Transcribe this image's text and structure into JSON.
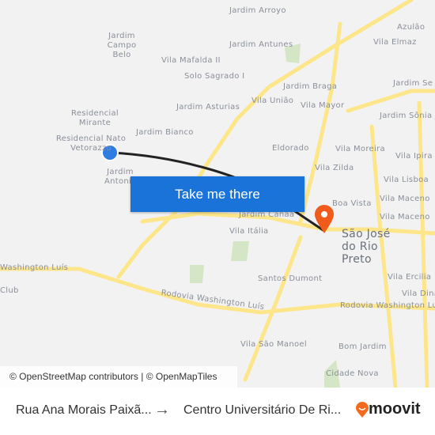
{
  "map": {
    "labels": [
      "Jardim Arroyo",
      "Azulão",
      "Jardim Campo Belo",
      "Jardim Antunes",
      "Vila Elmaz",
      "Vila Mafalda II",
      "Solo Sagrado I",
      "Jardim Braga",
      "Jardim Se",
      "Residencial Mirante",
      "Jardim Asturias",
      "Vila União",
      "Vila Mayor",
      "Jardim Sônia",
      "Jardim Bianco",
      "Residencial Nato Vetorazzo",
      "Eldorado",
      "Vila Moreira",
      "Vila Ipira",
      "Jardim Antonio",
      "Vila Zilda",
      "Vila Lisboa",
      "Jardim Canaã",
      "Boa Vista",
      "Vila Maceno",
      "Vila Maceno",
      "Vila Itália",
      "São José do Rio Preto",
      "Washington Luís",
      "Santos Dumont",
      "Vila Ercilia",
      "Rodovia Washington Luís",
      "Rodovia Washington Luís",
      "Vila Dina",
      "Vila São Manoel",
      "Bom Jardim",
      "Cidade Nova",
      "Club"
    ],
    "colors": {
      "road": "#fde68a",
      "route": "#222222",
      "origin": "#2f7de1",
      "destination": "#f05a1a",
      "park": "#d4e6c6"
    }
  },
  "cta": {
    "label": "Take me there"
  },
  "attribution": "© OpenStreetMap contributors | © OpenMapTiles",
  "footer": {
    "from": "Rua Ana Morais Paixã...",
    "arrow": "→",
    "to": "Centro Universitário De Ri...",
    "brand": "moovit"
  }
}
